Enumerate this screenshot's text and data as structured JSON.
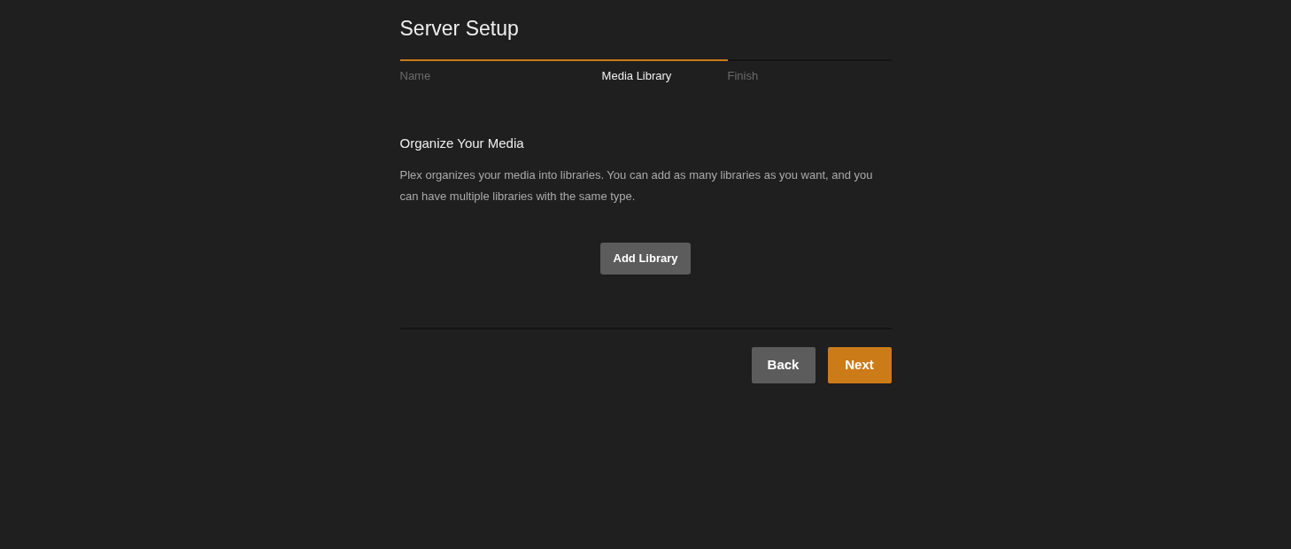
{
  "title": "Server Setup",
  "progress": {
    "level": 0.667
  },
  "steps": [
    {
      "label": "Name",
      "selected": false
    },
    {
      "label": "Media Library",
      "selected": true
    },
    {
      "label": "Finish",
      "selected": false
    }
  ],
  "section": {
    "heading": "Organize Your Media",
    "text": "Plex organizes your media into libraries. You can add as many libraries as you want, and you can have multiple libraries with the same type.",
    "button": "Add Library"
  },
  "buttons": [
    {
      "label": "Back",
      "kind": "secondary"
    },
    {
      "label": "Next",
      "kind": "primary"
    }
  ]
}
